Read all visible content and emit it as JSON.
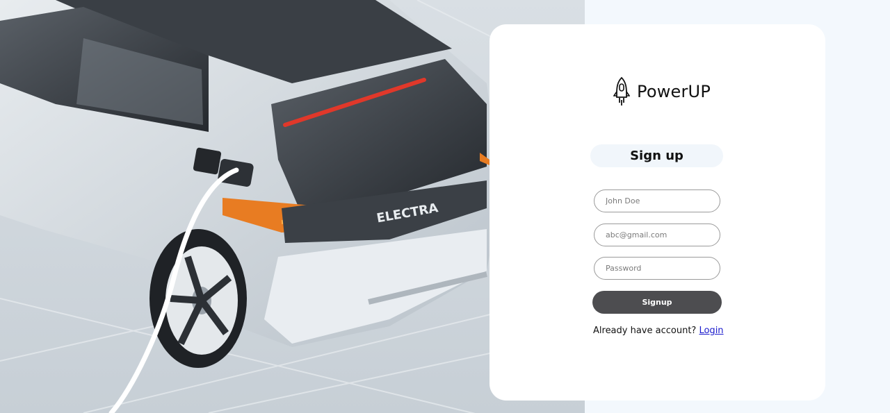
{
  "brand": {
    "name": "PowerUP"
  },
  "hero": {
    "badge_text": "ELECTRA"
  },
  "form": {
    "title": "Sign up",
    "fields": {
      "name_placeholder": "John Doe",
      "email_placeholder": "abc@gmail.com",
      "password_placeholder": "Password"
    },
    "submit_label": "Signup",
    "footer_prompt": "Already have account?",
    "login_link": "Login"
  },
  "colors": {
    "button_bg": "#4d4d50",
    "title_pill_bg": "#f1f6fb",
    "page_bg": "#f3f8fd",
    "link": "#1a1acc"
  },
  "icons": [
    "rocket-plug-logo-icon"
  ]
}
